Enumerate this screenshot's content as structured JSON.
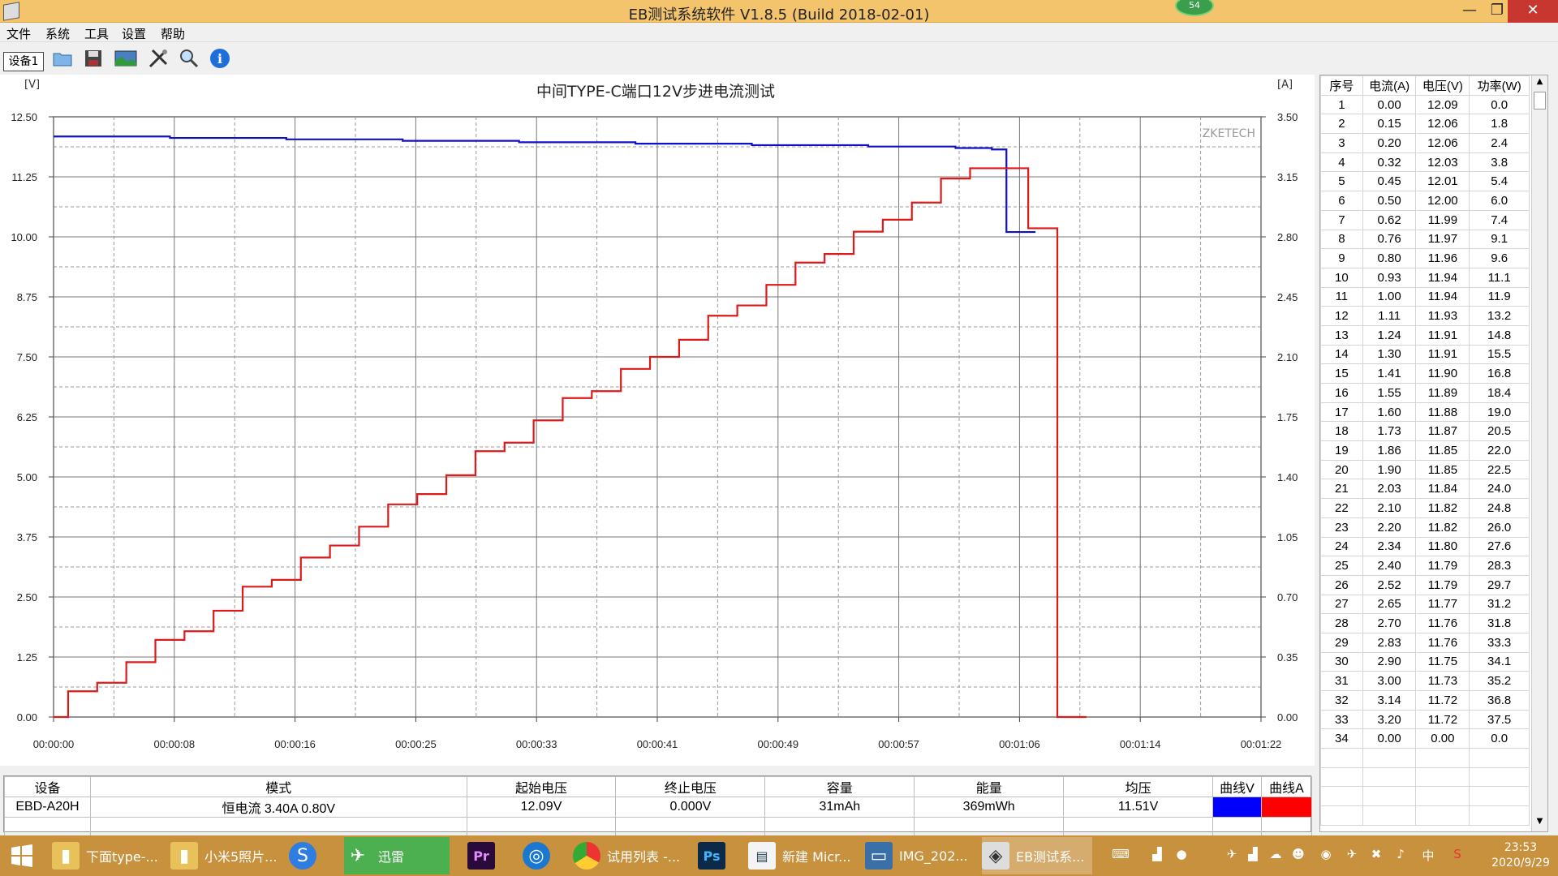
{
  "window": {
    "title": "EB测试系统软件 V1.8.5 (Build 2018-02-01)",
    "badge": "54",
    "min": "—",
    "max": "❐",
    "close": "✕"
  },
  "menu": [
    "文件",
    "系统",
    "工具",
    "设置",
    "帮助"
  ],
  "toolbar": {
    "device_tab": "设备1"
  },
  "chart_data": {
    "type": "line",
    "title": "中间TYPE-C端口12V步进电流测试",
    "watermark": "ZKETECH",
    "left_unit": "[V]",
    "right_unit": "[A]",
    "left_ticks": [
      "12.50",
      "11.25",
      "10.00",
      "8.75",
      "7.50",
      "6.25",
      "5.00",
      "3.75",
      "2.50",
      "1.25",
      "0.00"
    ],
    "right_ticks": [
      "3.50",
      "3.15",
      "2.80",
      "2.45",
      "2.10",
      "1.75",
      "1.40",
      "1.05",
      "0.70",
      "0.35",
      "0.00"
    ],
    "x_ticks": [
      "00:00:00",
      "00:00:08",
      "00:00:16",
      "00:00:25",
      "00:00:33",
      "00:00:41",
      "00:00:49",
      "00:00:57",
      "00:01:06",
      "00:01:14",
      "00:01:22"
    ],
    "ylim_left": [
      0,
      12.5
    ],
    "ylim_right": [
      0,
      3.5
    ],
    "xlim_seconds": [
      0,
      83
    ],
    "grid": true,
    "series": [
      {
        "name": "曲线V",
        "axis": "left",
        "color": "#1010c8",
        "points": [
          [
            0,
            12.09
          ],
          [
            8,
            12.06
          ],
          [
            16,
            12.03
          ],
          [
            24,
            12.0
          ],
          [
            32,
            11.97
          ],
          [
            40,
            11.94
          ],
          [
            48,
            11.91
          ],
          [
            56,
            11.88
          ],
          [
            62,
            11.85
          ],
          [
            64.5,
            11.82
          ],
          [
            65.5,
            11.82
          ],
          [
            65.5,
            10.1
          ],
          [
            67.5,
            10.1
          ]
        ]
      },
      {
        "name": "曲线A",
        "axis": "right",
        "color": "#dd1a1a",
        "step_time": 2,
        "values": [
          0.0,
          0.15,
          0.2,
          0.32,
          0.45,
          0.5,
          0.62,
          0.76,
          0.8,
          0.93,
          1.0,
          1.11,
          1.24,
          1.3,
          1.41,
          1.55,
          1.6,
          1.73,
          1.86,
          1.9,
          2.03,
          2.1,
          2.2,
          2.34,
          2.4,
          2.52,
          2.65,
          2.7,
          2.83,
          2.9,
          3.0,
          3.14,
          3.2,
          3.2,
          2.85,
          0.0
        ]
      }
    ]
  },
  "table": {
    "headers": [
      "序号",
      "电流(A)",
      "电压(V)",
      "功率(W)"
    ],
    "rows": [
      [
        "1",
        "0.00",
        "12.09",
        "0.0"
      ],
      [
        "2",
        "0.15",
        "12.06",
        "1.8"
      ],
      [
        "3",
        "0.20",
        "12.06",
        "2.4"
      ],
      [
        "4",
        "0.32",
        "12.03",
        "3.8"
      ],
      [
        "5",
        "0.45",
        "12.01",
        "5.4"
      ],
      [
        "6",
        "0.50",
        "12.00",
        "6.0"
      ],
      [
        "7",
        "0.62",
        "11.99",
        "7.4"
      ],
      [
        "8",
        "0.76",
        "11.97",
        "9.1"
      ],
      [
        "9",
        "0.80",
        "11.96",
        "9.6"
      ],
      [
        "10",
        "0.93",
        "11.94",
        "11.1"
      ],
      [
        "11",
        "1.00",
        "11.94",
        "11.9"
      ],
      [
        "12",
        "1.11",
        "11.93",
        "13.2"
      ],
      [
        "13",
        "1.24",
        "11.91",
        "14.8"
      ],
      [
        "14",
        "1.30",
        "11.91",
        "15.5"
      ],
      [
        "15",
        "1.41",
        "11.90",
        "16.8"
      ],
      [
        "16",
        "1.55",
        "11.89",
        "18.4"
      ],
      [
        "17",
        "1.60",
        "11.88",
        "19.0"
      ],
      [
        "18",
        "1.73",
        "11.87",
        "20.5"
      ],
      [
        "19",
        "1.86",
        "11.85",
        "22.0"
      ],
      [
        "20",
        "1.90",
        "11.85",
        "22.5"
      ],
      [
        "21",
        "2.03",
        "11.84",
        "24.0"
      ],
      [
        "22",
        "2.10",
        "11.82",
        "24.8"
      ],
      [
        "23",
        "2.20",
        "11.82",
        "26.0"
      ],
      [
        "24",
        "2.34",
        "11.80",
        "27.6"
      ],
      [
        "25",
        "2.40",
        "11.79",
        "28.3"
      ],
      [
        "26",
        "2.52",
        "11.79",
        "29.7"
      ],
      [
        "27",
        "2.65",
        "11.77",
        "31.2"
      ],
      [
        "28",
        "2.70",
        "11.76",
        "31.8"
      ],
      [
        "29",
        "2.83",
        "11.76",
        "33.3"
      ],
      [
        "30",
        "2.90",
        "11.75",
        "34.1"
      ],
      [
        "31",
        "3.00",
        "11.73",
        "35.2"
      ],
      [
        "32",
        "3.14",
        "11.72",
        "36.8"
      ],
      [
        "33",
        "3.20",
        "11.72",
        "37.5"
      ],
      [
        "34",
        "0.00",
        "0.00",
        "0.0"
      ]
    ]
  },
  "summary": {
    "headers": [
      "设备",
      "模式",
      "起始电压",
      "终止电压",
      "容量",
      "能量",
      "均压",
      "曲线V",
      "曲线A"
    ],
    "row": {
      "device": "EBD-A20H",
      "mode": "恒电流  3.40A  0.80V",
      "start_v": "12.09V",
      "end_v": "0.000V",
      "capacity": "31mAh",
      "energy": "369mWh",
      "avg_v": "11.51V"
    },
    "colors": {
      "v": "#0000ff",
      "a": "#ff0000"
    }
  },
  "taskbar": {
    "items": [
      "下面type-...",
      "小米5照片...",
      "",
      "迅雷",
      "",
      "",
      "试用列表 -...",
      "",
      "新建 Micr...",
      "IMG_202...",
      "EB测试系..."
    ],
    "tray_ime": "中",
    "time": "23:53",
    "date": "2020/9/29"
  }
}
